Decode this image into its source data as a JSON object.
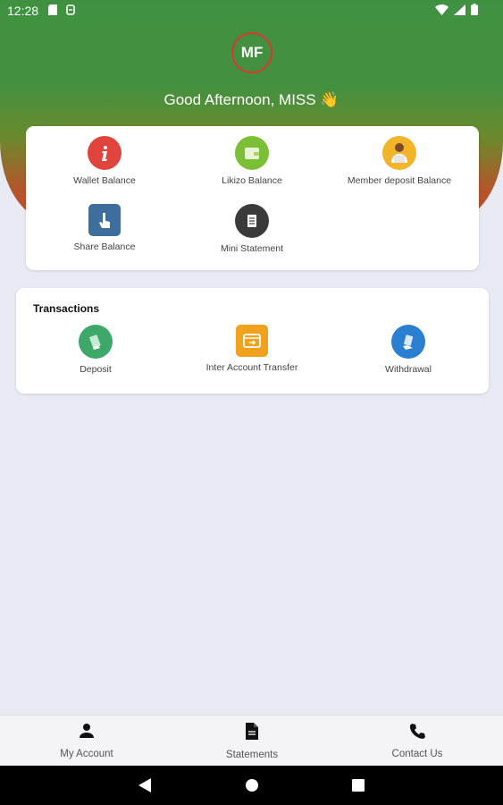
{
  "status_bar": {
    "time": "12:28"
  },
  "header": {
    "avatar_initials": "MF",
    "greeting": "Good Afternoon, MISS 👋"
  },
  "balances": [
    {
      "label": "Wallet Balance",
      "icon": "info-icon",
      "color": "#e0443c"
    },
    {
      "label": "Likizo Balance",
      "icon": "wallet-icon",
      "color": "#7bbf35"
    },
    {
      "label": "Member deposit Balance",
      "icon": "person-laptop-icon",
      "color": "#f2b52a"
    },
    {
      "label": "Share Balance",
      "icon": "touch-icon",
      "color": "#3d6e9c"
    },
    {
      "label": "Mini Statement",
      "icon": "receipt-icon",
      "color": "#3a3a3a"
    }
  ],
  "transactions": {
    "title": "Transactions",
    "items": [
      {
        "label": "Deposit",
        "icon": "deposit-icon",
        "color": "#3da86a"
      },
      {
        "label": "Inter Account Transfer",
        "icon": "transfer-icon",
        "color": "#f0a21c"
      },
      {
        "label": "Withdrawal",
        "icon": "withdrawal-icon",
        "color": "#2b7fd1"
      }
    ]
  },
  "bottom_nav": [
    {
      "label": "My Account",
      "icon": "person-icon"
    },
    {
      "label": "Statements",
      "icon": "document-icon"
    },
    {
      "label": "Contact Us",
      "icon": "phone-icon"
    }
  ]
}
